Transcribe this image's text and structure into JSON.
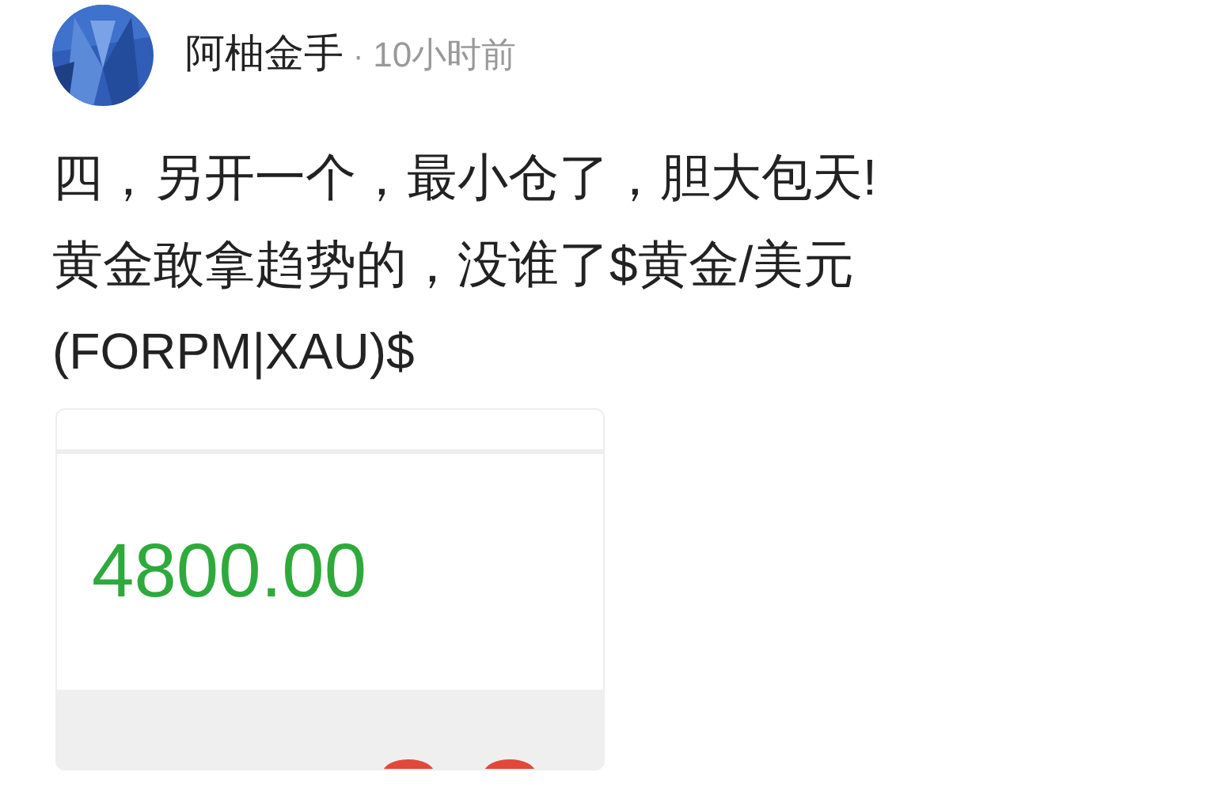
{
  "post": {
    "author": "阿柚金手",
    "separator": "·",
    "time": "10小时前",
    "lines": [
      "四，另开一个，最小仓了，胆大包天!",
      "黄金敢拿趋势的，没谁了$黄金/美元",
      "(FORPM|XAU)$"
    ],
    "card": {
      "price": "4800.00"
    }
  }
}
